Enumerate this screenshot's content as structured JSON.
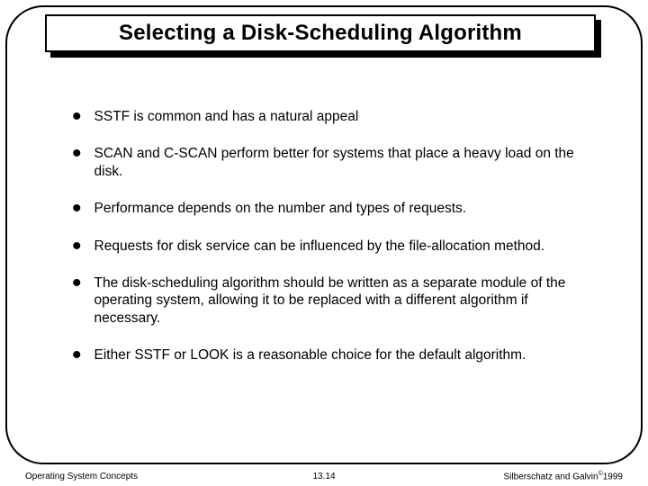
{
  "slide": {
    "title": "Selecting a Disk-Scheduling Algorithm",
    "bullets": [
      "SSTF is common and has a natural appeal",
      "SCAN and C-SCAN perform better for systems that place a heavy load on the disk.",
      "Performance depends on the number and types of requests.",
      "Requests for disk service can be influenced by the file-allocation method.",
      "The disk-scheduling algorithm should be written as a separate module of the operating system, allowing it to be replaced with a different algorithm if necessary.",
      "Either SSTF or LOOK is a reasonable choice for the default algorithm."
    ]
  },
  "footer": {
    "left": "Operating System Concepts",
    "center": "13.14",
    "right_prefix": "Silberschatz and Galvin",
    "right_suffix": "1999",
    "copyright": "©"
  }
}
